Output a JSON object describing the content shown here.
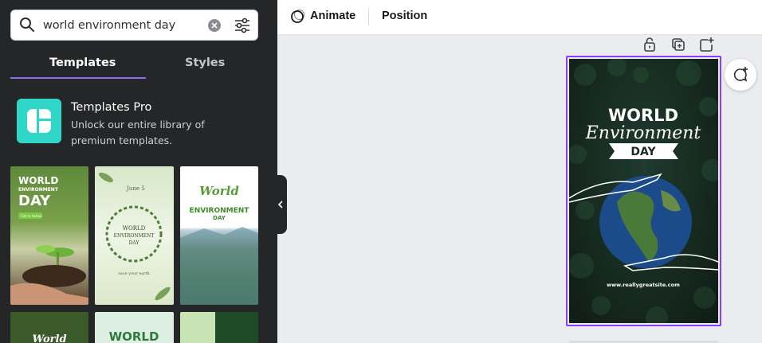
{
  "search": {
    "value": "world environment day"
  },
  "tabs": [
    {
      "label": "Templates",
      "active": true
    },
    {
      "label": "Styles",
      "active": false
    }
  ],
  "promo": {
    "title": "Templates Pro",
    "description": "Unlock our entire library of premium templates."
  },
  "toolbar": {
    "animate_label": "Animate",
    "position_label": "Position"
  },
  "template_thumbs": [
    {
      "title": "WORLD",
      "subtitle": "ENVIRONMENT",
      "day": "DAY",
      "button": "Call to Action"
    },
    {
      "date": "June 5",
      "title": "WORLD",
      "subtitle": "ENVIRONMENT",
      "day": "DAY",
      "footer": "save your earth"
    },
    {
      "title": "World",
      "subtitle": "ENVIRONMENT",
      "day": "DAY"
    },
    {
      "title": "World"
    },
    {
      "title": "WORLD"
    },
    {}
  ],
  "design": {
    "title": "WORLD",
    "script": "Environment",
    "day": "DAY",
    "url": "www.reallygreatsite.com"
  },
  "colors": {
    "panel_bg": "#252627",
    "accent": "#8b3dff",
    "tab_underline": "#8b6cf0",
    "pro_icon": "#2fd7c8"
  },
  "icons": [
    "search-icon",
    "clear-icon",
    "filter-icon",
    "templates-pro-icon",
    "chevron-left-icon",
    "animate-icon",
    "lock-icon",
    "duplicate-page-icon",
    "add-page-icon",
    "add-comment-icon"
  ]
}
